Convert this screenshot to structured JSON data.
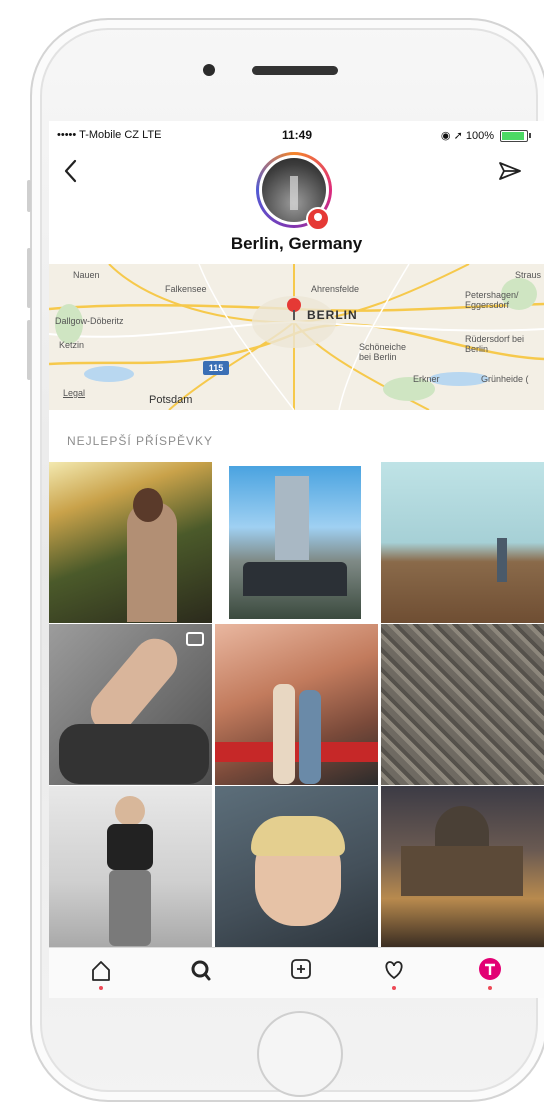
{
  "status_bar": {
    "carrier": "••••• T-Mobile CZ  LTE",
    "time": "11:49",
    "battery": "100%",
    "battery_level": 1.0
  },
  "header": {
    "location_name": "Berlin, Germany",
    "back_icon": "chevron-left-icon",
    "share_icon": "paper-plane-icon"
  },
  "map": {
    "city_label": "BERLIN",
    "labels": [
      "Nauen",
      "Falkensee",
      "Ahrensfelde",
      "Straus",
      "Petershagen/ Eggersdorf",
      "Dallgow-Döberitz",
      "Ketzin",
      "Schöneiche bei Berlin",
      "Rüdersdorf bei Berlin",
      "Erkner",
      "Grünheide (",
      "Potsdam",
      "Legal"
    ],
    "road_badge": "115"
  },
  "section": {
    "top_posts_title": "NEJLEPŠÍ PŘÍSPĚVKY"
  },
  "posts": [
    {
      "description": "man sunset river"
    },
    {
      "description": "tower group"
    },
    {
      "description": "field person"
    },
    {
      "description": "legs video"
    },
    {
      "description": "wall mural couple"
    },
    {
      "description": "aerial city"
    },
    {
      "description": "gym mirror selfie"
    },
    {
      "description": "car selfie"
    },
    {
      "description": "cathedral dusk"
    }
  ],
  "tabbar": {
    "items": [
      "home-icon",
      "search-icon",
      "add-icon",
      "heart-icon",
      "profile-icon"
    ]
  },
  "colors": {
    "accent_red": "#ed4956",
    "map_bg": "#f3efe5",
    "section_gray": "#8e8e8e"
  }
}
